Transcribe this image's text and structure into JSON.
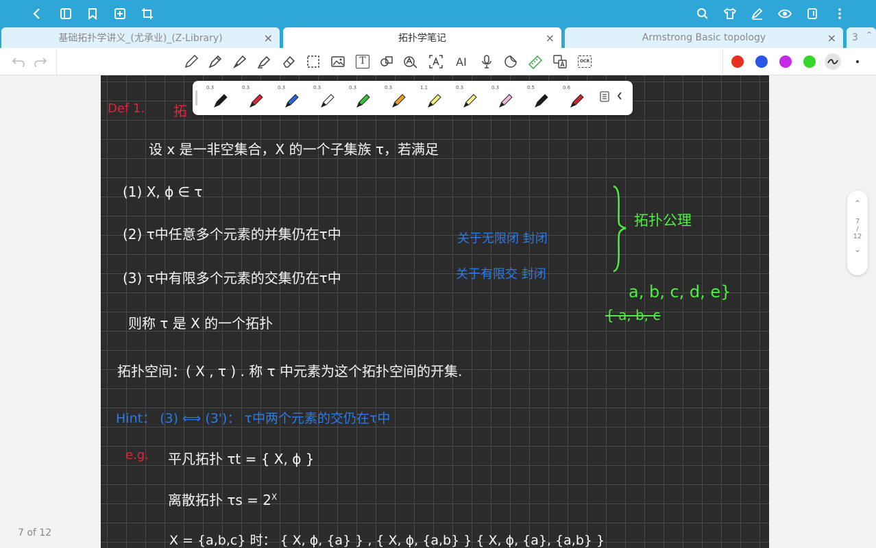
{
  "tabs": [
    {
      "label": "基础拓扑学讲义_(尤承业)_(Z-Library)"
    },
    {
      "label": "拓扑学笔记"
    },
    {
      "label": "Armstrong Basic topology"
    },
    {
      "label": "3"
    }
  ],
  "toolbar": {
    "text_tool": "T",
    "ai_tool": "AI",
    "ocr_tool": "OCR",
    "colors": [
      "#e8301f",
      "#2a56e8",
      "#c62ae8",
      "#37d62a"
    ]
  },
  "pens": [
    {
      "size": "0.3",
      "color": "#1a1a1a"
    },
    {
      "size": "0.3",
      "color": "#d7263a"
    },
    {
      "size": "0.3",
      "color": "#2a66d8"
    },
    {
      "size": "0.3",
      "color": "#ffffff"
    },
    {
      "size": "0.3",
      "color": "#33c33a"
    },
    {
      "size": "0.3",
      "color": "#e8a324"
    },
    {
      "size": "1.1",
      "color": "#f1f07a"
    },
    {
      "size": "0.3",
      "color": "#f5ee8c"
    },
    {
      "size": "0.3",
      "color": "#f4b8d8"
    },
    {
      "size": "0.5",
      "color": "#1a1a1a"
    },
    {
      "size": "0.6",
      "color": "#c8272f"
    }
  ],
  "notes": {
    "def_label": "Def 1.",
    "def_title": "拓",
    "line1": "设 x 是一非空集合，X 的一个子集族 τ，若满足",
    "c1": "(1)  X, ϕ ∈ τ",
    "c2": "(2)  τ中任意多个元素的并集仍在τ中",
    "c3": "(3)  τ中有限多个元素的交集仍在τ中",
    "c2_note": "关于无限闭 封闭",
    "c3_note": "关于有限交 封闭",
    "axiom_label": "拓扑公理",
    "abc": "a, b, c, d, e}",
    "abc_struck": "{ a, b, c",
    "then": "则称 τ 是 X 的一个拓扑",
    "space": "拓扑空间：( X , τ ) .  称 τ 中元素为这个拓扑空间的开集.",
    "hint": "Hint：  (3) ⟺ (3')：  τ中两个元素的交仍在τ中",
    "eg": "e.g.",
    "trivial": "平凡拓扑   τt = { X, ϕ }",
    "discrete": "离散拓扑   τs = 2",
    "discrete_sup": "X",
    "xset": "X = {a,b,c}  时：    { X, ϕ, {a} } ,  { X, ϕ, {a,b} }      { X, ϕ, {a}, {a,b} }"
  },
  "pager": {
    "up": "⌃",
    "current": "7",
    "sep": "/",
    "total": "12",
    "down": "⌄"
  },
  "page_count": "7 of 12"
}
